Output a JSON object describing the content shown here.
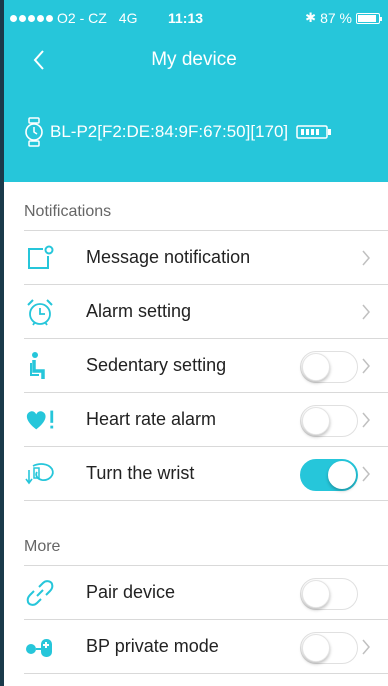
{
  "colors": {
    "accent": "#26c6da",
    "text": "#222222",
    "muted": "#666666"
  },
  "statusbar": {
    "carrier": "O2 - CZ",
    "network": "4G",
    "time": "11:13",
    "battery": "87 %"
  },
  "navbar": {
    "title": "My device",
    "back_icon": "chevron-left-icon"
  },
  "device": {
    "name": "BL-P2[F2:DE:84:9F:67:50][170]",
    "icon": "watch-icon",
    "battery_icon": "battery-icon"
  },
  "notifications": {
    "title": "Notifications",
    "items": [
      {
        "label": "Message notification",
        "icon": "message-icon",
        "control": "chevron"
      },
      {
        "label": "Alarm setting",
        "icon": "alarm-clock-icon",
        "control": "chevron"
      },
      {
        "label": "Sedentary setting",
        "icon": "seated-person-icon",
        "control": "toggle",
        "on": false
      },
      {
        "label": "Heart rate alarm",
        "icon": "heart-alert-icon",
        "control": "toggle",
        "on": false
      },
      {
        "label": "Turn the wrist",
        "icon": "wrist-turn-icon",
        "control": "toggle",
        "on": true
      }
    ]
  },
  "more": {
    "title": "More",
    "items": [
      {
        "label": "Pair device",
        "icon": "link-icon",
        "control": "toggle",
        "on": false
      },
      {
        "label": "BP private mode",
        "icon": "blood-pressure-icon",
        "control": "toggle",
        "on": false
      }
    ]
  }
}
